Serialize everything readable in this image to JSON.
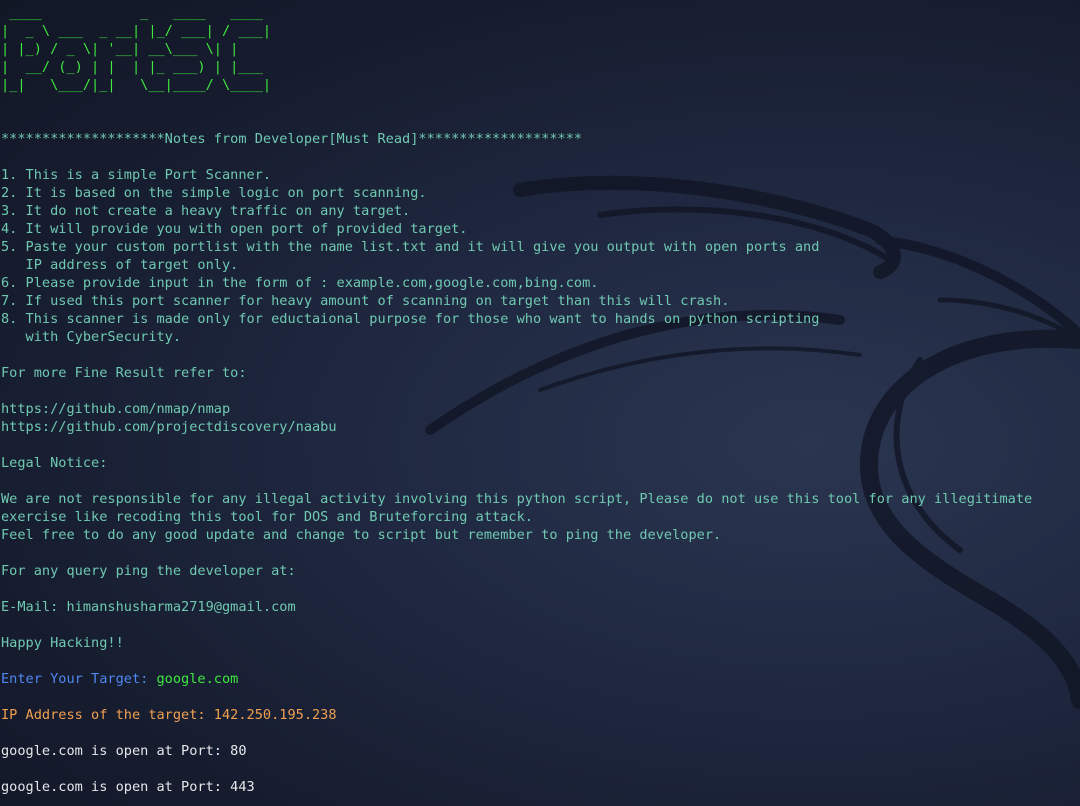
{
  "banner_lines": [
    " ____            _   ____   ____ ",
    "|  _ \\ ___  _ __| |_/ ___| / ___|",
    "| |_) / _ \\| '__| __\\___ \\| |    ",
    "|  __/ (_) | |  | |_ ___) | |___ ",
    "|_|   \\___/|_|   \\__|____/ \\____|"
  ],
  "notes_header": "********************Notes from Developer[Must Read]********************",
  "notes": [
    "1. This is a simple Port Scanner.",
    "2. It is based on the simple logic on port scanning.",
    "3. It do not create a heavy traffic on any target.",
    "4. It will provide you with open port of provided target.",
    "5. Paste your custom portlist with the name list.txt and it will give you output with open ports and",
    "   IP address of target only.",
    "6. Please provide input in the form of : example.com,google.com,bing.com.",
    "7. If used this port scanner for heavy amount of scanning on target than this will crash.",
    "8. This scanner is made only for eductaional purpose for those who want to hands on python scripting",
    "   with CyberSecurity."
  ],
  "more_result_text": "For more Fine Result refer to:",
  "links": [
    "https://github.com/nmap/nmap",
    "https://github.com/projectdiscovery/naabu"
  ],
  "legal_title": "Legal Notice:",
  "legal_lines": [
    "We are not responsible for any illegal activity involving this python script, Please do not use this tool for any illegitimate",
    "exercise like recoding this tool for DOS and Bruteforcing attack.",
    "Feel free to do any good update and change to script but remember to ping the developer."
  ],
  "query_text": "For any query ping the developer at:",
  "email_line": "E-Mail: himanshusharma2719@gmail.com",
  "happy_text": "Happy Hacking!!",
  "prompt": {
    "label": "Enter Your Target: ",
    "value": "google.com"
  },
  "ip_line": "IP Address of the target: 142.250.195.238",
  "results": [
    "google.com is open at Port: 80",
    "google.com is open at Port: 443"
  ],
  "colors": {
    "background": "#1b2236",
    "text": "#6fc9b1",
    "banner": "#3ee83e",
    "prompt_label": "#4f86f0",
    "prompt_value": "#3ee83e",
    "ip": "#f0a050",
    "results": "#e4e6ea"
  }
}
